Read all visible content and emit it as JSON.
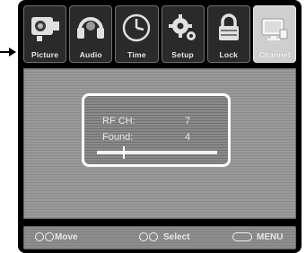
{
  "tabs": [
    {
      "label": "Picture",
      "icon": "picture-icon",
      "active": false
    },
    {
      "label": "Audio",
      "icon": "audio-icon",
      "active": false
    },
    {
      "label": "Time",
      "icon": "clock-icon",
      "active": false
    },
    {
      "label": "Setup",
      "icon": "gear-icon",
      "active": false
    },
    {
      "label": "Lock",
      "icon": "lock-icon",
      "active": false
    },
    {
      "label": "Channel",
      "icon": "channel-icon",
      "active": true
    }
  ],
  "scan": {
    "rf_ch_label": "RF CH:",
    "rf_ch_value": "7",
    "found_label": "Found:",
    "found_value": "4",
    "progress": 0.22
  },
  "footer": {
    "move": "Move",
    "select": "Select",
    "menu": "MENU"
  },
  "colors": {
    "frame": "#000000",
    "panel": "#9a9a9a",
    "highlight": "#ffffff"
  }
}
